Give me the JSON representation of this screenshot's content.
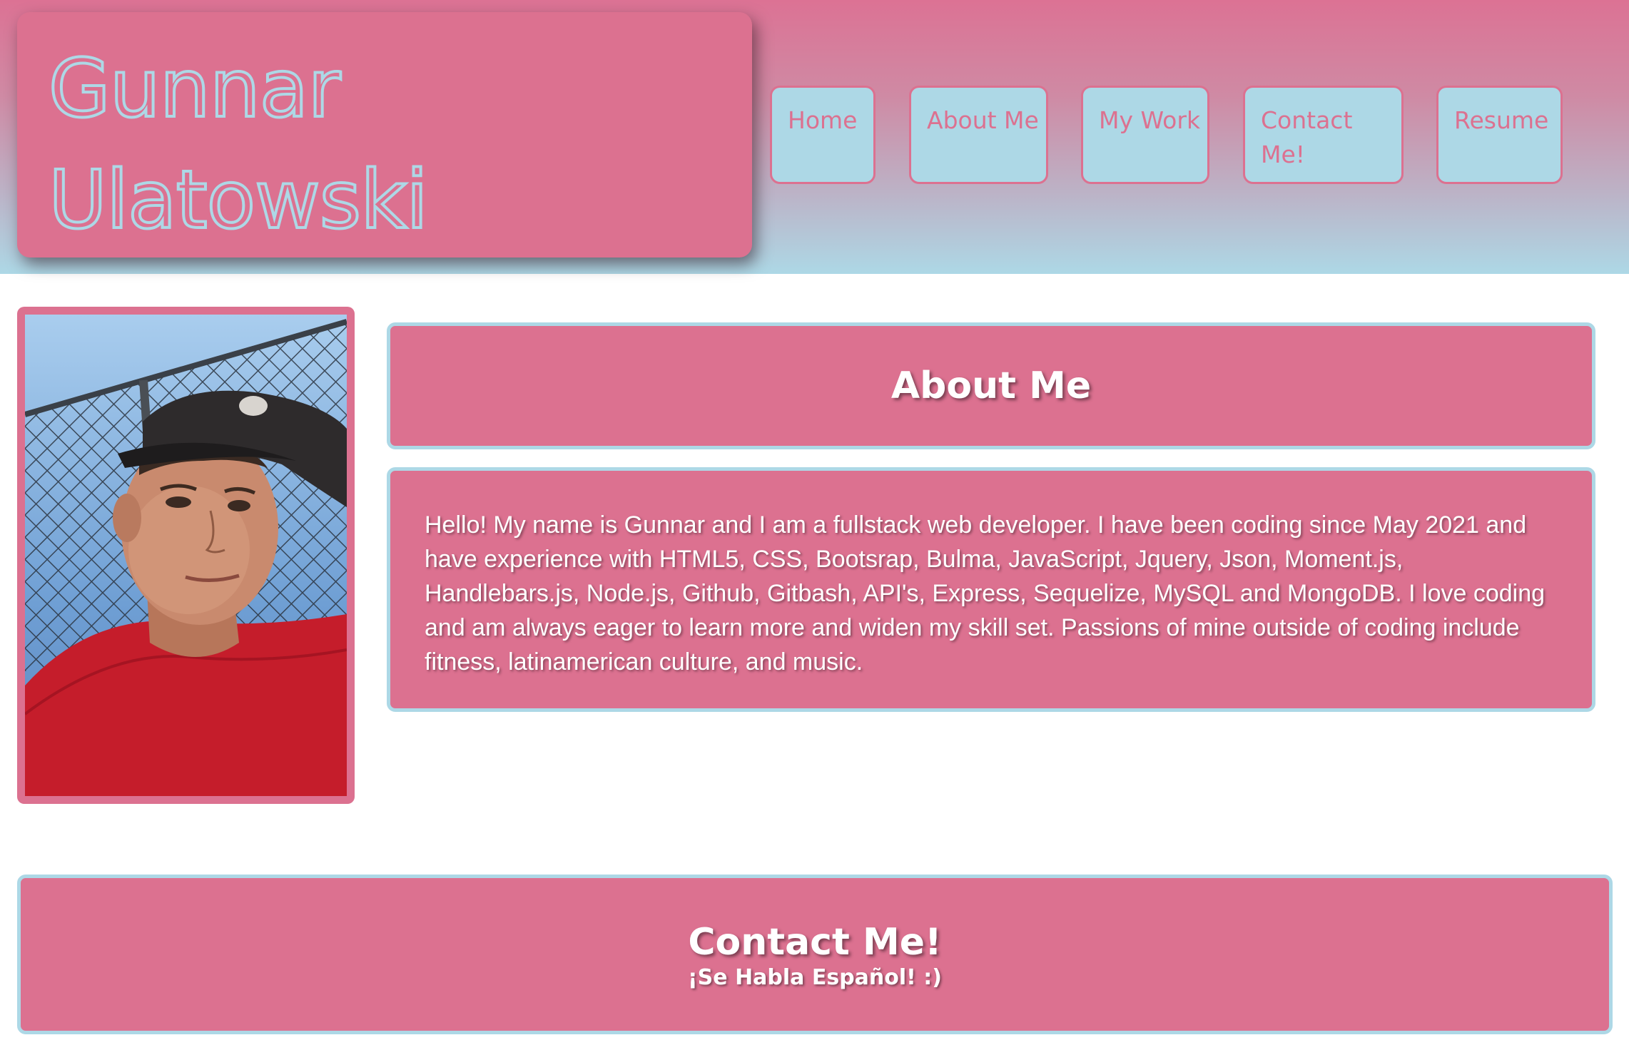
{
  "header": {
    "name_first": "Gunnar",
    "name_last": "Ulatowski",
    "nav": {
      "home": "Home",
      "about": "About Me",
      "work": "My Work",
      "contact": "Contact Me!",
      "resume": "Resume"
    }
  },
  "about": {
    "title": "About Me",
    "body": "Hello! My name is Gunnar and I am a fullstack web developer. I have been coding since May 2021 and have experience with HTML5, CSS, Bootsrap, Bulma, JavaScript, Jquery, Json, Moment.js, Handlebars.js, Node.js, Github, Gitbash, API's, Express, Sequelize, MySQL and MongoDB. I love coding and am always eager to learn more and widen my skill set. Passions of mine outside of coding include fitness, latinamerican culture, and music."
  },
  "contact": {
    "title": "Contact Me!",
    "subtitle": "¡Se Habla Español! :)"
  },
  "colors": {
    "pink": "#dc7190",
    "light_blue": "#add8e6",
    "white": "#ffffff"
  },
  "icons": {
    "profile_photo": "profile-photo"
  }
}
